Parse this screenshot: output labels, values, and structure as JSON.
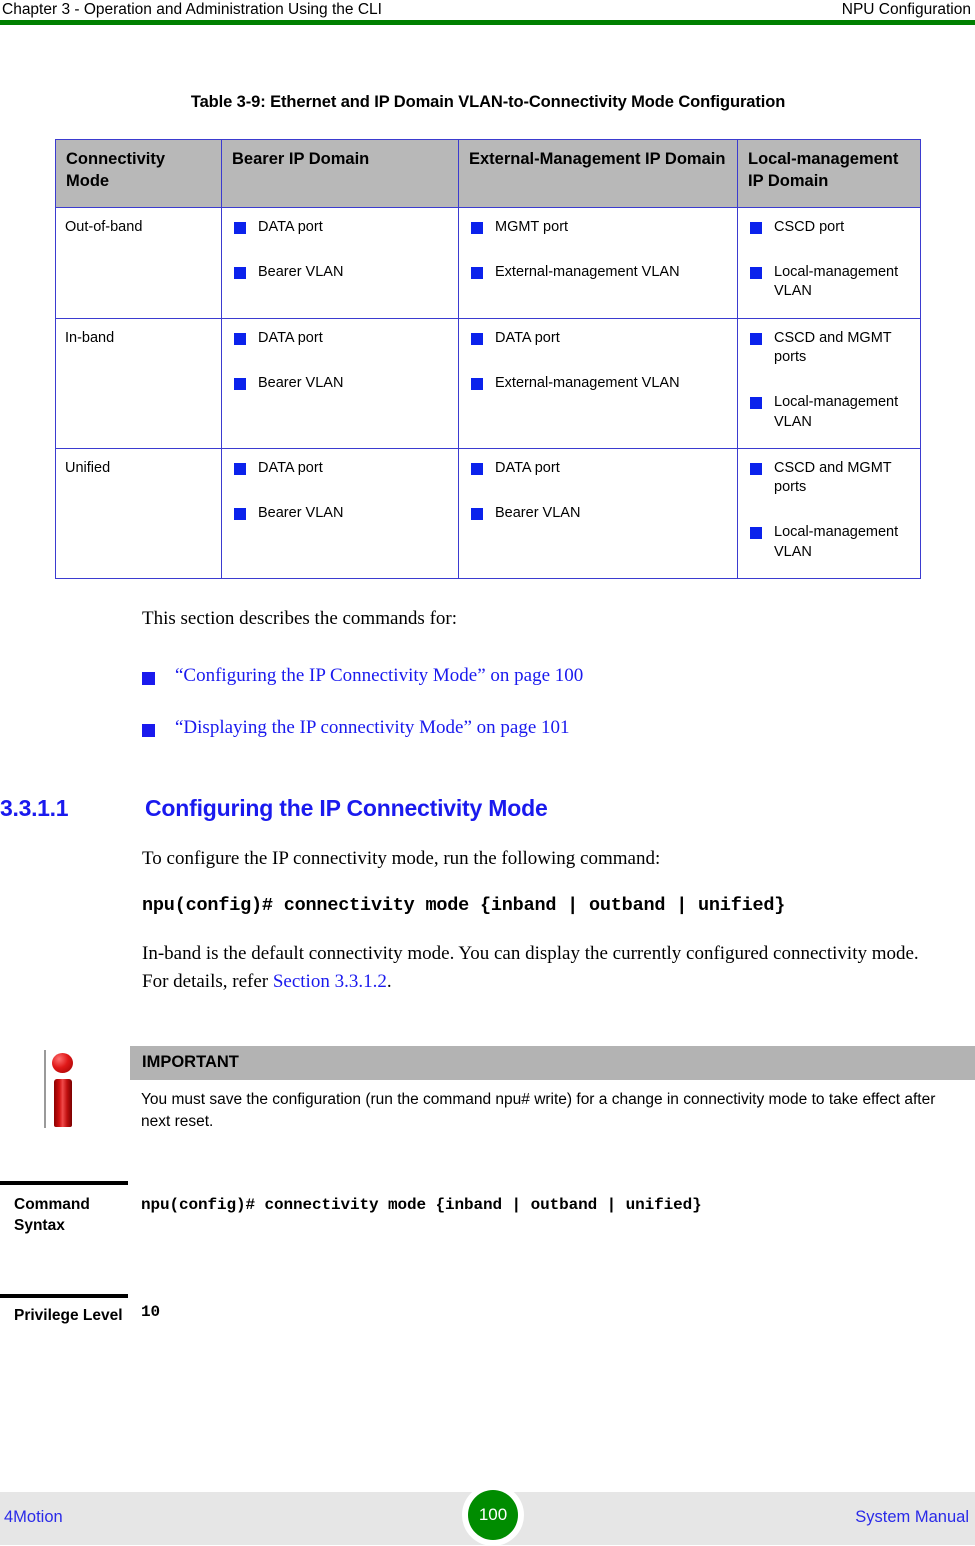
{
  "header": {
    "left": "Chapter 3 - Operation and Administration Using the CLI",
    "right": "NPU Configuration",
    "rule_color": "#008000"
  },
  "table": {
    "caption": "Table 3-9: Ethernet and IP Domain VLAN-to-Connectivity Mode Configuration",
    "columns": [
      "Connectivity Mode",
      "Bearer IP Domain",
      "External-Management IP Domain",
      "Local-management IP Domain"
    ],
    "header_bg": "#b8b8b8",
    "border_color": "#3b3bd0",
    "bullet_color": "#0b22ec",
    "rows": [
      {
        "mode": "Out-of-band",
        "bearer": [
          "DATA port",
          "Bearer VLAN"
        ],
        "external": [
          "MGMT port",
          "External-management VLAN"
        ],
        "local": [
          "CSCD port",
          "Local-management VLAN"
        ]
      },
      {
        "mode": "In-band",
        "bearer": [
          "DATA port",
          "Bearer VLAN"
        ],
        "external": [
          "DATA port",
          "External-management VLAN"
        ],
        "local": [
          "CSCD and MGMT ports",
          "Local-management VLAN"
        ]
      },
      {
        "mode": "Unified",
        "bearer": [
          "DATA port",
          "Bearer VLAN"
        ],
        "external": [
          "DATA port",
          "Bearer VLAN"
        ],
        "local": [
          "CSCD and MGMT ports",
          "Local-management VLAN"
        ]
      }
    ]
  },
  "body": {
    "intro": "This section describes the commands for:",
    "links": [
      "“Configuring the IP Connectivity Mode” on page 100",
      "“Displaying the IP connectivity Mode” on page 101"
    ],
    "link_color": "#1a1aee"
  },
  "section": {
    "number": "3.3.1.1",
    "title": "Configuring the IP Connectivity Mode",
    "lead": "To configure the IP connectivity mode, run the following command:",
    "command": "npu(config)# connectivity mode {inband | outband | unified}",
    "note_before": "In-band is the default connectivity mode. You can display the currently configured connectivity mode. For details, refer ",
    "note_xref": "Section 3.3.1.2",
    "note_after": "."
  },
  "important": {
    "label": "IMPORTANT",
    "text": "You must save the configuration (run the command npu# write)  for a change in connectivity mode to take effect after next reset.",
    "band_color": "#b3b3b3",
    "icon_color": "#d01010"
  },
  "syntax_block": {
    "rows": [
      {
        "label": "Command Syntax",
        "value": "npu(config)# connectivity mode {inband | outband | unified}"
      },
      {
        "label": "Privilege Level",
        "value": "10"
      }
    ]
  },
  "footer": {
    "left": "4Motion",
    "page": "100",
    "right": "System Manual",
    "bg": "#e6e6e6",
    "badge_color": "#008c00",
    "text_color": "#2a2ae8"
  }
}
